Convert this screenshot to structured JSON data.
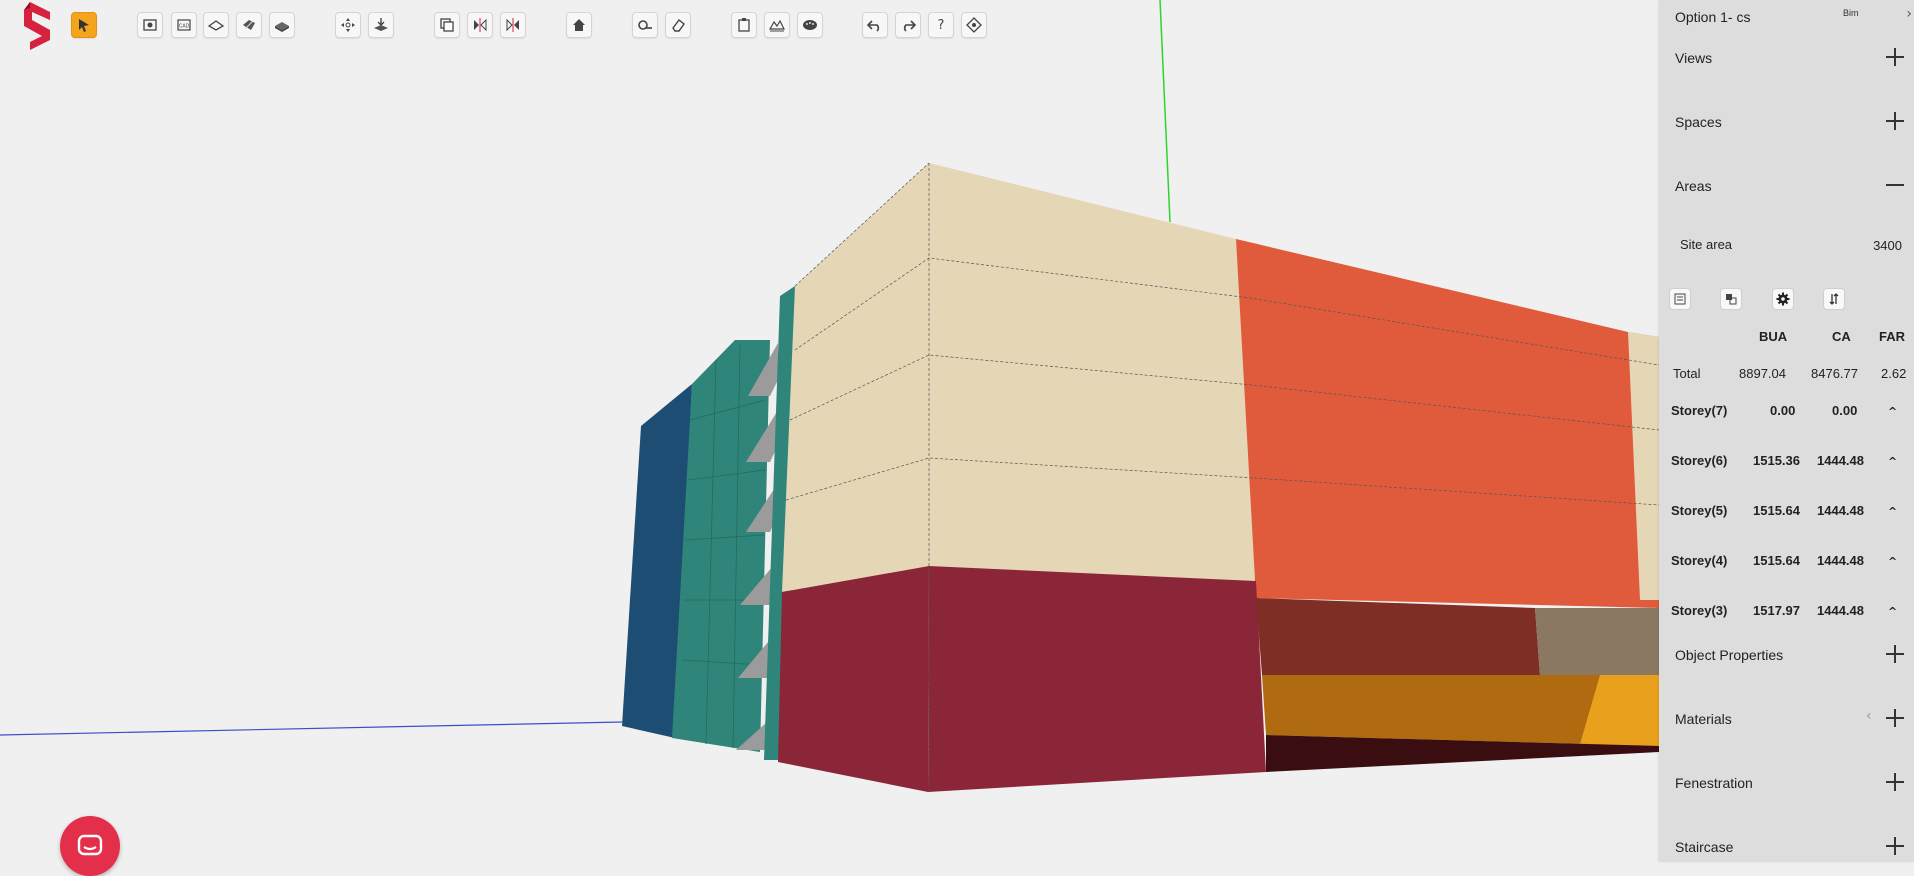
{
  "app": {
    "logo": "snaptrude-logo"
  },
  "toolbar": {
    "buttons": [
      {
        "name": "select-tool",
        "icon": "cursor-icon",
        "active": true
      },
      {
        "name": "import-image-button",
        "icon": "image-import-icon"
      },
      {
        "name": "import-cad-button",
        "icon": "cad-import-icon",
        "label": "CAD"
      },
      {
        "name": "draw-plane-button",
        "icon": "plane-icon"
      },
      {
        "name": "draw-polygon-button",
        "icon": "polygon-icon"
      },
      {
        "name": "draw-slab-button",
        "icon": "slab-icon"
      },
      {
        "name": "move-button",
        "icon": "move-icon"
      },
      {
        "name": "push-pull-button",
        "icon": "push-pull-icon"
      },
      {
        "name": "copy-button",
        "icon": "copy-icon"
      },
      {
        "name": "mirror-x-button",
        "icon": "mirror-icon"
      },
      {
        "name": "mirror-y-button",
        "icon": "mirror-icon"
      },
      {
        "name": "home-view-button",
        "icon": "home-icon"
      },
      {
        "name": "measure-button",
        "icon": "tape-measure-icon"
      },
      {
        "name": "eraser-button",
        "icon": "eraser-icon"
      },
      {
        "name": "copy-paste-button",
        "icon": "clipboard-icon"
      },
      {
        "name": "terrain-button",
        "icon": "terrain-icon"
      },
      {
        "name": "material-paint-button",
        "icon": "paint-icon"
      },
      {
        "name": "undo-button",
        "icon": "undo-icon"
      },
      {
        "name": "redo-button",
        "icon": "redo-icon"
      },
      {
        "name": "help-button",
        "icon": "help-icon",
        "label": "?"
      },
      {
        "name": "settings-view-button",
        "icon": "view-settings-icon"
      }
    ]
  },
  "panel": {
    "title": "Option 1- cs",
    "bim": "Bim",
    "close": "›",
    "sections": {
      "views": "Views",
      "spaces": "Spaces",
      "areas": "Areas",
      "object_properties": "Object Properties",
      "materials": "Materials",
      "fenestration": "Fenestration",
      "staircase": "Staircase"
    },
    "site_area_label": "Site area",
    "site_area_value": "3400",
    "area_tools": [
      "report-icon",
      "layers-icon",
      "gear-icon",
      "sort-icon"
    ],
    "table": {
      "headers": [
        "BUA",
        "CA",
        "FAR"
      ],
      "total": {
        "label": "Total",
        "bua": "8897.04",
        "ca": "8476.77",
        "far": "2.62"
      },
      "storeys": [
        {
          "label": "Storey(7)",
          "bua": "0.00",
          "ca": "0.00",
          "toggle": "^"
        },
        {
          "label": "Storey(6)",
          "bua": "1515.36",
          "ca": "1444.48",
          "toggle": "^"
        },
        {
          "label": "Storey(5)",
          "bua": "1515.64",
          "ca": "1444.48",
          "toggle": "^"
        },
        {
          "label": "Storey(4)",
          "bua": "1515.64",
          "ca": "1444.48",
          "toggle": "^"
        },
        {
          "label": "Storey(3)",
          "bua": "1517.97",
          "ca": "1444.48",
          "toggle": "^"
        }
      ]
    },
    "materials_arrow": "‹"
  },
  "colors": {
    "accent": "#f4a51c",
    "beige": "#e5d7b6",
    "orange_red": "#e05b3c",
    "crimson": "#8b2638",
    "teal": "#2f8579",
    "navy": "#1d4d73",
    "amber": "#e9a01c",
    "chat": "#e42f4a"
  }
}
